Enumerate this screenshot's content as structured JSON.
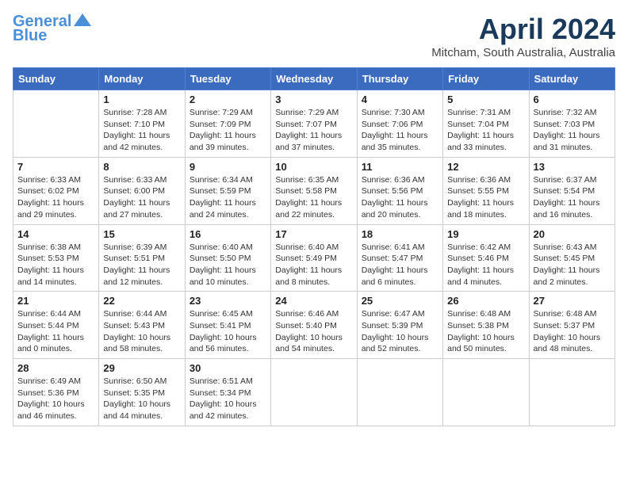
{
  "header": {
    "logo_line1": "General",
    "logo_line2": "Blue",
    "month": "April 2024",
    "location": "Mitcham, South Australia, Australia"
  },
  "weekdays": [
    "Sunday",
    "Monday",
    "Tuesday",
    "Wednesday",
    "Thursday",
    "Friday",
    "Saturday"
  ],
  "weeks": [
    [
      {
        "day": "",
        "info": ""
      },
      {
        "day": "1",
        "info": "Sunrise: 7:28 AM\nSunset: 7:10 PM\nDaylight: 11 hours\nand 42 minutes."
      },
      {
        "day": "2",
        "info": "Sunrise: 7:29 AM\nSunset: 7:09 PM\nDaylight: 11 hours\nand 39 minutes."
      },
      {
        "day": "3",
        "info": "Sunrise: 7:29 AM\nSunset: 7:07 PM\nDaylight: 11 hours\nand 37 minutes."
      },
      {
        "day": "4",
        "info": "Sunrise: 7:30 AM\nSunset: 7:06 PM\nDaylight: 11 hours\nand 35 minutes."
      },
      {
        "day": "5",
        "info": "Sunrise: 7:31 AM\nSunset: 7:04 PM\nDaylight: 11 hours\nand 33 minutes."
      },
      {
        "day": "6",
        "info": "Sunrise: 7:32 AM\nSunset: 7:03 PM\nDaylight: 11 hours\nand 31 minutes."
      }
    ],
    [
      {
        "day": "7",
        "info": "Sunrise: 6:33 AM\nSunset: 6:02 PM\nDaylight: 11 hours\nand 29 minutes."
      },
      {
        "day": "8",
        "info": "Sunrise: 6:33 AM\nSunset: 6:00 PM\nDaylight: 11 hours\nand 27 minutes."
      },
      {
        "day": "9",
        "info": "Sunrise: 6:34 AM\nSunset: 5:59 PM\nDaylight: 11 hours\nand 24 minutes."
      },
      {
        "day": "10",
        "info": "Sunrise: 6:35 AM\nSunset: 5:58 PM\nDaylight: 11 hours\nand 22 minutes."
      },
      {
        "day": "11",
        "info": "Sunrise: 6:36 AM\nSunset: 5:56 PM\nDaylight: 11 hours\nand 20 minutes."
      },
      {
        "day": "12",
        "info": "Sunrise: 6:36 AM\nSunset: 5:55 PM\nDaylight: 11 hours\nand 18 minutes."
      },
      {
        "day": "13",
        "info": "Sunrise: 6:37 AM\nSunset: 5:54 PM\nDaylight: 11 hours\nand 16 minutes."
      }
    ],
    [
      {
        "day": "14",
        "info": "Sunrise: 6:38 AM\nSunset: 5:53 PM\nDaylight: 11 hours\nand 14 minutes."
      },
      {
        "day": "15",
        "info": "Sunrise: 6:39 AM\nSunset: 5:51 PM\nDaylight: 11 hours\nand 12 minutes."
      },
      {
        "day": "16",
        "info": "Sunrise: 6:40 AM\nSunset: 5:50 PM\nDaylight: 11 hours\nand 10 minutes."
      },
      {
        "day": "17",
        "info": "Sunrise: 6:40 AM\nSunset: 5:49 PM\nDaylight: 11 hours\nand 8 minutes."
      },
      {
        "day": "18",
        "info": "Sunrise: 6:41 AM\nSunset: 5:47 PM\nDaylight: 11 hours\nand 6 minutes."
      },
      {
        "day": "19",
        "info": "Sunrise: 6:42 AM\nSunset: 5:46 PM\nDaylight: 11 hours\nand 4 minutes."
      },
      {
        "day": "20",
        "info": "Sunrise: 6:43 AM\nSunset: 5:45 PM\nDaylight: 11 hours\nand 2 minutes."
      }
    ],
    [
      {
        "day": "21",
        "info": "Sunrise: 6:44 AM\nSunset: 5:44 PM\nDaylight: 11 hours\nand 0 minutes."
      },
      {
        "day": "22",
        "info": "Sunrise: 6:44 AM\nSunset: 5:43 PM\nDaylight: 10 hours\nand 58 minutes."
      },
      {
        "day": "23",
        "info": "Sunrise: 6:45 AM\nSunset: 5:41 PM\nDaylight: 10 hours\nand 56 minutes."
      },
      {
        "day": "24",
        "info": "Sunrise: 6:46 AM\nSunset: 5:40 PM\nDaylight: 10 hours\nand 54 minutes."
      },
      {
        "day": "25",
        "info": "Sunrise: 6:47 AM\nSunset: 5:39 PM\nDaylight: 10 hours\nand 52 minutes."
      },
      {
        "day": "26",
        "info": "Sunrise: 6:48 AM\nSunset: 5:38 PM\nDaylight: 10 hours\nand 50 minutes."
      },
      {
        "day": "27",
        "info": "Sunrise: 6:48 AM\nSunset: 5:37 PM\nDaylight: 10 hours\nand 48 minutes."
      }
    ],
    [
      {
        "day": "28",
        "info": "Sunrise: 6:49 AM\nSunset: 5:36 PM\nDaylight: 10 hours\nand 46 minutes."
      },
      {
        "day": "29",
        "info": "Sunrise: 6:50 AM\nSunset: 5:35 PM\nDaylight: 10 hours\nand 44 minutes."
      },
      {
        "day": "30",
        "info": "Sunrise: 6:51 AM\nSunset: 5:34 PM\nDaylight: 10 hours\nand 42 minutes."
      },
      {
        "day": "",
        "info": ""
      },
      {
        "day": "",
        "info": ""
      },
      {
        "day": "",
        "info": ""
      },
      {
        "day": "",
        "info": ""
      }
    ]
  ]
}
